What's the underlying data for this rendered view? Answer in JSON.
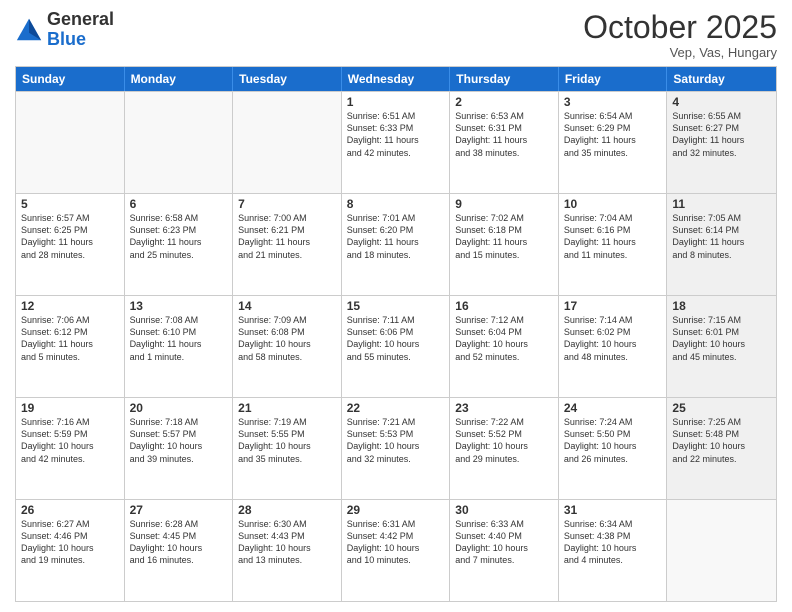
{
  "header": {
    "logo_general": "General",
    "logo_blue": "Blue",
    "month": "October 2025",
    "location": "Vep, Vas, Hungary"
  },
  "days_of_week": [
    "Sunday",
    "Monday",
    "Tuesday",
    "Wednesday",
    "Thursday",
    "Friday",
    "Saturday"
  ],
  "weeks": [
    [
      {
        "day": "",
        "text": "",
        "empty": true
      },
      {
        "day": "",
        "text": "",
        "empty": true
      },
      {
        "day": "",
        "text": "",
        "empty": true
      },
      {
        "day": "1",
        "text": "Sunrise: 6:51 AM\nSunset: 6:33 PM\nDaylight: 11 hours\nand 42 minutes.",
        "empty": false
      },
      {
        "day": "2",
        "text": "Sunrise: 6:53 AM\nSunset: 6:31 PM\nDaylight: 11 hours\nand 38 minutes.",
        "empty": false
      },
      {
        "day": "3",
        "text": "Sunrise: 6:54 AM\nSunset: 6:29 PM\nDaylight: 11 hours\nand 35 minutes.",
        "empty": false
      },
      {
        "day": "4",
        "text": "Sunrise: 6:55 AM\nSunset: 6:27 PM\nDaylight: 11 hours\nand 32 minutes.",
        "empty": false,
        "shaded": true
      }
    ],
    [
      {
        "day": "5",
        "text": "Sunrise: 6:57 AM\nSunset: 6:25 PM\nDaylight: 11 hours\nand 28 minutes.",
        "empty": false
      },
      {
        "day": "6",
        "text": "Sunrise: 6:58 AM\nSunset: 6:23 PM\nDaylight: 11 hours\nand 25 minutes.",
        "empty": false
      },
      {
        "day": "7",
        "text": "Sunrise: 7:00 AM\nSunset: 6:21 PM\nDaylight: 11 hours\nand 21 minutes.",
        "empty": false
      },
      {
        "day": "8",
        "text": "Sunrise: 7:01 AM\nSunset: 6:20 PM\nDaylight: 11 hours\nand 18 minutes.",
        "empty": false
      },
      {
        "day": "9",
        "text": "Sunrise: 7:02 AM\nSunset: 6:18 PM\nDaylight: 11 hours\nand 15 minutes.",
        "empty": false
      },
      {
        "day": "10",
        "text": "Sunrise: 7:04 AM\nSunset: 6:16 PM\nDaylight: 11 hours\nand 11 minutes.",
        "empty": false
      },
      {
        "day": "11",
        "text": "Sunrise: 7:05 AM\nSunset: 6:14 PM\nDaylight: 11 hours\nand 8 minutes.",
        "empty": false,
        "shaded": true
      }
    ],
    [
      {
        "day": "12",
        "text": "Sunrise: 7:06 AM\nSunset: 6:12 PM\nDaylight: 11 hours\nand 5 minutes.",
        "empty": false
      },
      {
        "day": "13",
        "text": "Sunrise: 7:08 AM\nSunset: 6:10 PM\nDaylight: 11 hours\nand 1 minute.",
        "empty": false
      },
      {
        "day": "14",
        "text": "Sunrise: 7:09 AM\nSunset: 6:08 PM\nDaylight: 10 hours\nand 58 minutes.",
        "empty": false
      },
      {
        "day": "15",
        "text": "Sunrise: 7:11 AM\nSunset: 6:06 PM\nDaylight: 10 hours\nand 55 minutes.",
        "empty": false
      },
      {
        "day": "16",
        "text": "Sunrise: 7:12 AM\nSunset: 6:04 PM\nDaylight: 10 hours\nand 52 minutes.",
        "empty": false
      },
      {
        "day": "17",
        "text": "Sunrise: 7:14 AM\nSunset: 6:02 PM\nDaylight: 10 hours\nand 48 minutes.",
        "empty": false
      },
      {
        "day": "18",
        "text": "Sunrise: 7:15 AM\nSunset: 6:01 PM\nDaylight: 10 hours\nand 45 minutes.",
        "empty": false,
        "shaded": true
      }
    ],
    [
      {
        "day": "19",
        "text": "Sunrise: 7:16 AM\nSunset: 5:59 PM\nDaylight: 10 hours\nand 42 minutes.",
        "empty": false
      },
      {
        "day": "20",
        "text": "Sunrise: 7:18 AM\nSunset: 5:57 PM\nDaylight: 10 hours\nand 39 minutes.",
        "empty": false
      },
      {
        "day": "21",
        "text": "Sunrise: 7:19 AM\nSunset: 5:55 PM\nDaylight: 10 hours\nand 35 minutes.",
        "empty": false
      },
      {
        "day": "22",
        "text": "Sunrise: 7:21 AM\nSunset: 5:53 PM\nDaylight: 10 hours\nand 32 minutes.",
        "empty": false
      },
      {
        "day": "23",
        "text": "Sunrise: 7:22 AM\nSunset: 5:52 PM\nDaylight: 10 hours\nand 29 minutes.",
        "empty": false
      },
      {
        "day": "24",
        "text": "Sunrise: 7:24 AM\nSunset: 5:50 PM\nDaylight: 10 hours\nand 26 minutes.",
        "empty": false
      },
      {
        "day": "25",
        "text": "Sunrise: 7:25 AM\nSunset: 5:48 PM\nDaylight: 10 hours\nand 22 minutes.",
        "empty": false,
        "shaded": true
      }
    ],
    [
      {
        "day": "26",
        "text": "Sunrise: 6:27 AM\nSunset: 4:46 PM\nDaylight: 10 hours\nand 19 minutes.",
        "empty": false
      },
      {
        "day": "27",
        "text": "Sunrise: 6:28 AM\nSunset: 4:45 PM\nDaylight: 10 hours\nand 16 minutes.",
        "empty": false
      },
      {
        "day": "28",
        "text": "Sunrise: 6:30 AM\nSunset: 4:43 PM\nDaylight: 10 hours\nand 13 minutes.",
        "empty": false
      },
      {
        "day": "29",
        "text": "Sunrise: 6:31 AM\nSunset: 4:42 PM\nDaylight: 10 hours\nand 10 minutes.",
        "empty": false
      },
      {
        "day": "30",
        "text": "Sunrise: 6:33 AM\nSunset: 4:40 PM\nDaylight: 10 hours\nand 7 minutes.",
        "empty": false
      },
      {
        "day": "31",
        "text": "Sunrise: 6:34 AM\nSunset: 4:38 PM\nDaylight: 10 hours\nand 4 minutes.",
        "empty": false
      },
      {
        "day": "",
        "text": "",
        "empty": true,
        "shaded": true
      }
    ]
  ]
}
